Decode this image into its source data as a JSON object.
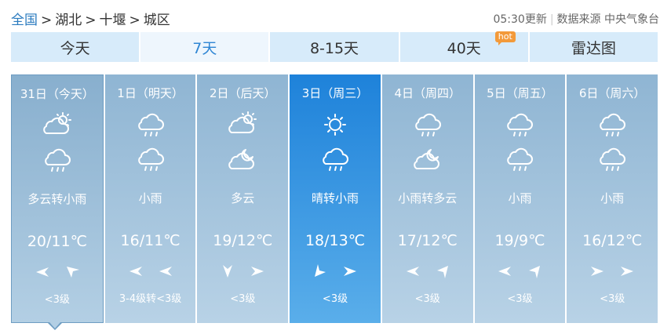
{
  "breadcrumb": {
    "home": "全国",
    "province": "湖北",
    "city": "十堰",
    "district": "城区",
    "separator": ">"
  },
  "meta": {
    "update_time": "05:30更新",
    "source": "数据来源 中央气象台"
  },
  "tabs": [
    {
      "label": "今天",
      "active": false
    },
    {
      "label": "7天",
      "active": true
    },
    {
      "label": "8-15天",
      "active": false
    },
    {
      "label": "40天",
      "active": false,
      "badge": "hot"
    },
    {
      "label": "雷达图",
      "active": false
    }
  ],
  "days": [
    {
      "date": "31日（今天）",
      "icon_day": "partly-cloudy-icon",
      "icon_night": "light-rain-icon",
      "condition": "多云转小雨",
      "temp": "20/11℃",
      "wind_dir": [
        "left",
        "up-left-from-right"
      ],
      "wind_level": "<3级"
    },
    {
      "date": "1日（明天）",
      "icon_day": "light-rain-icon",
      "icon_night": "light-rain-icon",
      "condition": "小雨",
      "temp": "16/11℃",
      "wind_dir": [
        "left",
        "left"
      ],
      "wind_level": "3-4级转<3级"
    },
    {
      "date": "2日（后天）",
      "icon_day": "partly-cloudy-icon",
      "icon_night": "cloudy-night-icon",
      "condition": "多云",
      "temp": "19/12℃",
      "wind_dir": [
        "down",
        "right"
      ],
      "wind_level": "<3级"
    },
    {
      "date": "3日（周三）",
      "icon_day": "sunny-icon",
      "icon_night": "light-rain-icon",
      "condition": "晴转小雨",
      "temp": "18/13℃",
      "wind_dir": [
        "down-left",
        "right"
      ],
      "wind_level": "<3级"
    },
    {
      "date": "4日（周四）",
      "icon_day": "light-rain-icon",
      "icon_night": "cloudy-night-icon",
      "condition": "小雨转多云",
      "temp": "17/12℃",
      "wind_dir": [
        "left",
        "up-right"
      ],
      "wind_level": "<3级"
    },
    {
      "date": "5日（周五）",
      "icon_day": "light-rain-icon",
      "icon_night": "light-rain-icon",
      "condition": "小雨",
      "temp": "19/9℃",
      "wind_dir": [
        "left",
        "up-right"
      ],
      "wind_level": "<3级"
    },
    {
      "date": "6日（周六）",
      "icon_day": "light-rain-icon",
      "icon_night": "light-rain-icon",
      "condition": "小雨",
      "temp": "16/12℃",
      "wind_dir": [
        "right",
        "right"
      ],
      "wind_level": "<3级"
    }
  ],
  "colors": {
    "accent": "#2f86d4",
    "tab_bg": "#d7ebfa",
    "highlight": "#1e82da",
    "card": "#9dbdd8"
  }
}
